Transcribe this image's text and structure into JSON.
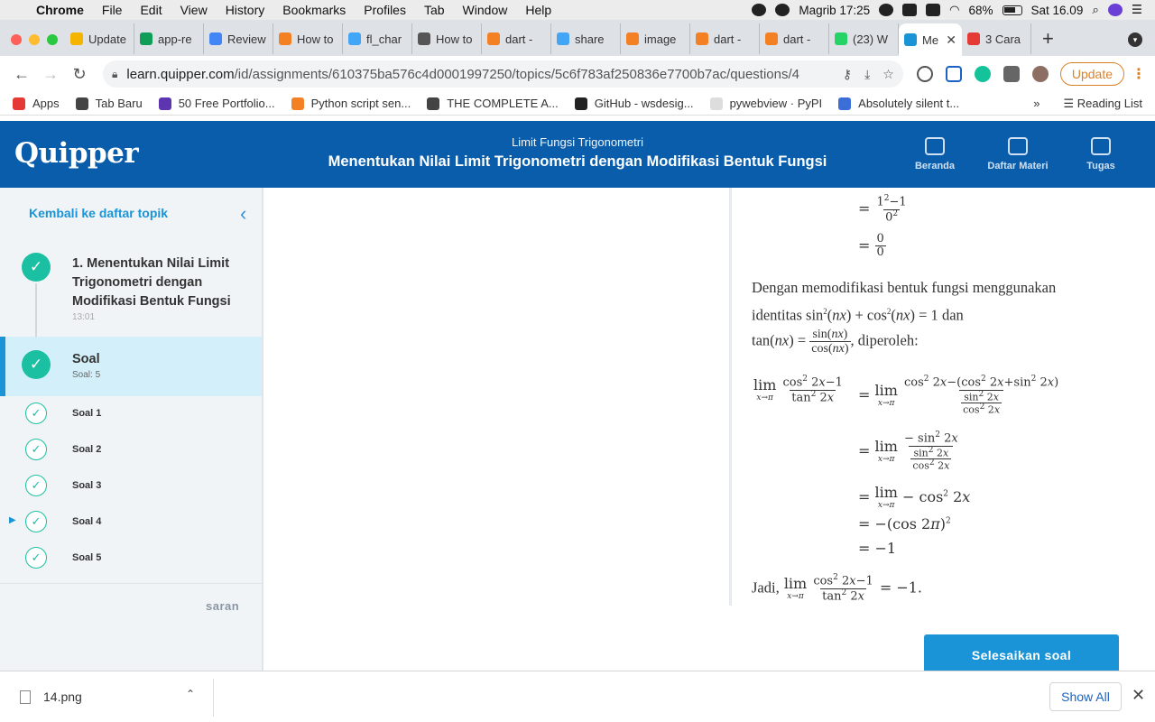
{
  "menubar": {
    "app": "Chrome",
    "items": [
      "File",
      "Edit",
      "View",
      "History",
      "Bookmarks",
      "Profiles",
      "Tab",
      "Window",
      "Help"
    ],
    "status": "Magrib 17:25",
    "battery": "68%",
    "datetime": "Sat 16.09"
  },
  "tabs": [
    {
      "label": "Update",
      "color": "#f4b400"
    },
    {
      "label": "app-re",
      "color": "#0f9d58"
    },
    {
      "label": "Review",
      "color": "#4285f4"
    },
    {
      "label": "How to",
      "color": "#f48024"
    },
    {
      "label": "fl_char",
      "color": "#42a5f5"
    },
    {
      "label": "How to",
      "color": "#555555"
    },
    {
      "label": "dart -",
      "color": "#f48024"
    },
    {
      "label": "share",
      "color": "#42a5f5"
    },
    {
      "label": "image",
      "color": "#f48024"
    },
    {
      "label": "dart -",
      "color": "#f48024"
    },
    {
      "label": "dart -",
      "color": "#f48024"
    },
    {
      "label": "(23) W",
      "color": "#25d366"
    },
    {
      "label": "Me",
      "color": "#1a94d6",
      "active": true
    },
    {
      "label": "3 Cara",
      "color": "#e53935"
    }
  ],
  "address": {
    "host": "learn.quipper.com",
    "path": "/id/assignments/610375ba576c4d0001997250/topics/5c6f783af250836e7700b7ac/questions/4",
    "update_label": "Update"
  },
  "bookmarks": [
    {
      "label": "Apps",
      "color": "#e53935"
    },
    {
      "label": "Tab Baru",
      "color": "#444444"
    },
    {
      "label": "50 Free Portfolio...",
      "color": "#5e35b1"
    },
    {
      "label": "Python script sen...",
      "color": "#f48024"
    },
    {
      "label": "THE COMPLETE A...",
      "color": "#444444"
    },
    {
      "label": "GitHub - wsdesig...",
      "color": "#222222"
    },
    {
      "label": "pywebview · PyPI",
      "color": "#dddddd"
    },
    {
      "label": "Absolutely silent t...",
      "color": "#3b6ed6"
    }
  ],
  "bookmarks_more": "»",
  "reading_list": "Reading List",
  "header": {
    "logo": "Quipper",
    "subtitle": "Limit Fungsi Trigonometri",
    "title": "Menentukan Nilai Limit Trigonometri dengan Modifikasi Bentuk Fungsi",
    "nav": [
      "Beranda",
      "Daftar Materi",
      "Tugas"
    ]
  },
  "sidebar": {
    "back": "Kembali ke daftar topik",
    "topic_title": "1. Menentukan Nilai Limit Trigonometri dengan Modifikasi Bentuk Fungsi",
    "topic_duration": "13:01",
    "section_title": "Soal",
    "section_count": "Soal: 5",
    "questions": [
      "Soal 1",
      "Soal 2",
      "Soal 3",
      "Soal 4",
      "Soal 5"
    ],
    "current_question": "Soal 4",
    "feedback": "saran"
  },
  "solution": {
    "p1a": "Dengan memodifikasi bentuk fungsi menggunakan",
    "p1b": "identitas",
    "p1c": "dan",
    "p1d": ", diperoleh:",
    "jadi": "Jadi,",
    "result": "= −1."
  },
  "finish_button": "Selesaikan soal",
  "download": {
    "file": "14.png",
    "show_all": "Show All"
  }
}
